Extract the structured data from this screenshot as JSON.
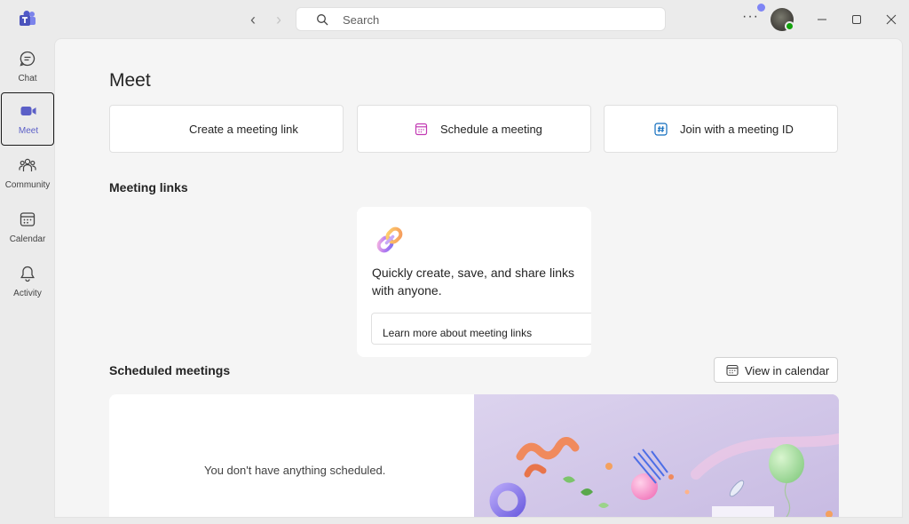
{
  "titlebar": {
    "search_placeholder": "Search",
    "more_label": "···"
  },
  "rail": {
    "items": [
      {
        "label": "Chat",
        "icon": "chat-icon"
      },
      {
        "label": "Meet",
        "icon": "video-camera-icon",
        "active": true
      },
      {
        "label": "Community",
        "icon": "community-icon"
      },
      {
        "label": "Calendar",
        "icon": "calendar-icon"
      },
      {
        "label": "Activity",
        "icon": "bell-icon"
      }
    ]
  },
  "main": {
    "title": "Meet",
    "actions": {
      "create": "Create a meeting link",
      "schedule": "Schedule a meeting",
      "join": "Join with a meeting ID"
    },
    "meeting_links": {
      "heading": "Meeting links",
      "card_text": "Quickly create, save, and share links with anyone.",
      "learn_more": "Learn more about meeting links"
    },
    "scheduled": {
      "heading": "Scheduled meetings",
      "view_calendar": "View in calendar",
      "empty_text": "You don't have anything scheduled."
    }
  },
  "colors": {
    "brand": "#5b5fc7",
    "presence": "#13a10e",
    "notification": "#7f85f5"
  }
}
